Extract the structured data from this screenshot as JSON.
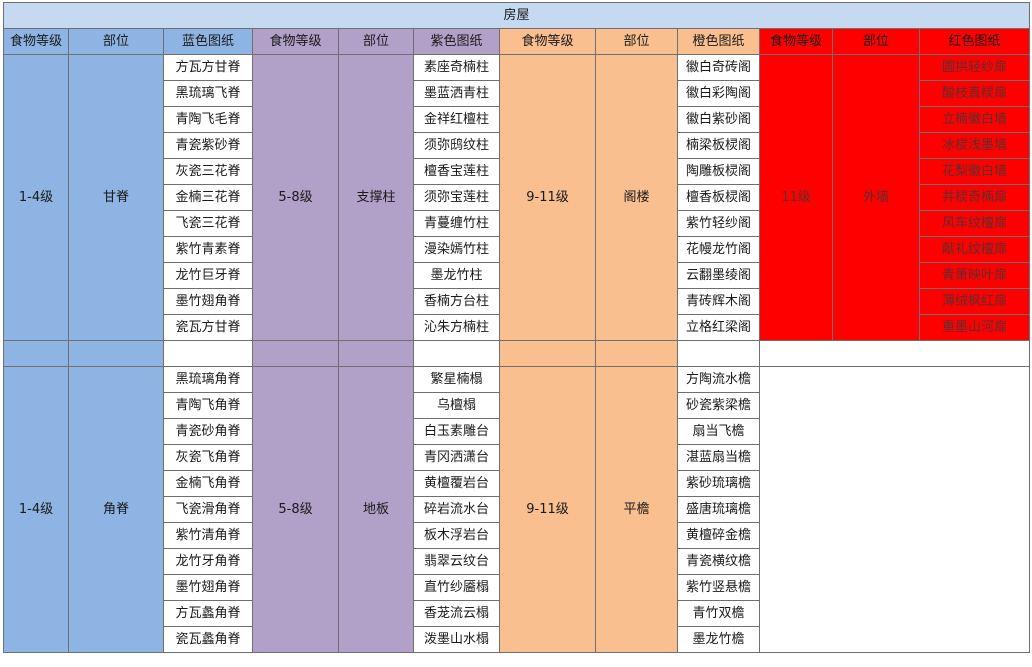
{
  "title": "房屋",
  "headers": [
    "食物等级",
    "部位",
    "蓝色图纸",
    "食物等级",
    "部位",
    "紫色图纸",
    "食物等级",
    "部位",
    "橙色图纸",
    "食物等级",
    "部位",
    "红色图纸"
  ],
  "block1": {
    "blue_level": "1-4级",
    "blue_part": "甘脊",
    "purple_level": "5-8级",
    "purple_part": "支撑柱",
    "orange_level": "9-11级",
    "orange_part": "阁楼",
    "red_level": "11级",
    "red_part": "外墙",
    "rows": [
      {
        "blue": "方瓦方甘脊",
        "purple": "素座奇楠柱",
        "orange": "徽白奇砖阁",
        "red": "圆拱轻纱扉"
      },
      {
        "blue": "黑琉璃飞脊",
        "purple": "墨蓝洒青柱",
        "orange": "徽白彩陶阁",
        "red": "酸枝直棂扉"
      },
      {
        "blue": "青陶飞毛脊",
        "purple": "金祥红檀柱",
        "orange": "徽白紫砂阁",
        "red": "立楠徽白墙"
      },
      {
        "blue": "青瓷紫砂脊",
        "purple": "须弥鸱纹柱",
        "orange": "楠梁板棂阁",
        "red": "冰棂浅墨墙"
      },
      {
        "blue": "灰瓷三花脊",
        "purple": "檀香宝莲柱",
        "orange": "陶雕板棂阁",
        "red": "花梨徽白墙"
      },
      {
        "blue": "金楠三花脊",
        "purple": "须弥宝莲柱",
        "orange": "檀香板棂阁",
        "red": "井棂奇楠扉"
      },
      {
        "blue": "飞瓷三花脊",
        "purple": "青蔓缠竹柱",
        "orange": "紫竹轻纱阁",
        "red": "风车纹檀扉"
      },
      {
        "blue": "紫竹青素脊",
        "purple": "漫染嫣竹柱",
        "orange": "花幔龙竹阁",
        "red": "献礼纹檀扉"
      },
      {
        "blue": "龙竹巨牙脊",
        "purple": "墨龙竹柱",
        "orange": "云翻墨绫阁",
        "red": "青萧映叶扉"
      },
      {
        "blue": "墨竹翅角脊",
        "purple": "香楠方台柱",
        "orange": "青砖辉木阁",
        "red": "薄绒枫红扉"
      },
      {
        "blue": "瓷瓦方甘脊",
        "purple": "沁朱方楠柱",
        "orange": "立格红梁阁",
        "red": "重墨山河扉"
      }
    ]
  },
  "block2": {
    "blue_level": "1-4级",
    "blue_part": "角脊",
    "purple_level": "5-8级",
    "purple_part": "地板",
    "orange_level": "9-11级",
    "orange_part": "平檐",
    "rows": [
      {
        "blue": "黑琉璃角脊",
        "purple": "繁星楠榻",
        "orange": "方陶流水檐"
      },
      {
        "blue": "青陶飞角脊",
        "purple": "乌檀榻",
        "orange": "砂瓷紫梁檐"
      },
      {
        "blue": "青瓷砂角脊",
        "purple": "白玉素雕台",
        "orange": "扇当飞檐"
      },
      {
        "blue": "灰瓷飞角脊",
        "purple": "青冈洒潇台",
        "orange": "湛蓝扇当檐"
      },
      {
        "blue": "金楠飞角脊",
        "purple": "黄檀覆岩台",
        "orange": "紫砂琉璃檐"
      },
      {
        "blue": "飞瓷滑角脊",
        "purple": "碎岩流水台",
        "orange": "盛唐琉璃檐"
      },
      {
        "blue": "紫竹清角脊",
        "purple": "板木浮岩台",
        "orange": "黄檀碎金檐"
      },
      {
        "blue": "龙竹牙角脊",
        "purple": "翡翠云纹台",
        "orange": "青瓷横纹檐"
      },
      {
        "blue": "墨竹翅角脊",
        "purple": "直竹纱靥榻",
        "orange": "紫竹竖悬檐"
      },
      {
        "blue": "方瓦蠡角脊",
        "purple": "香茏流云榻",
        "orange": "青竹双檐"
      },
      {
        "blue": "瓷瓦蠡角脊",
        "purple": "泼墨山水榻",
        "orange": "墨龙竹檐"
      }
    ]
  }
}
